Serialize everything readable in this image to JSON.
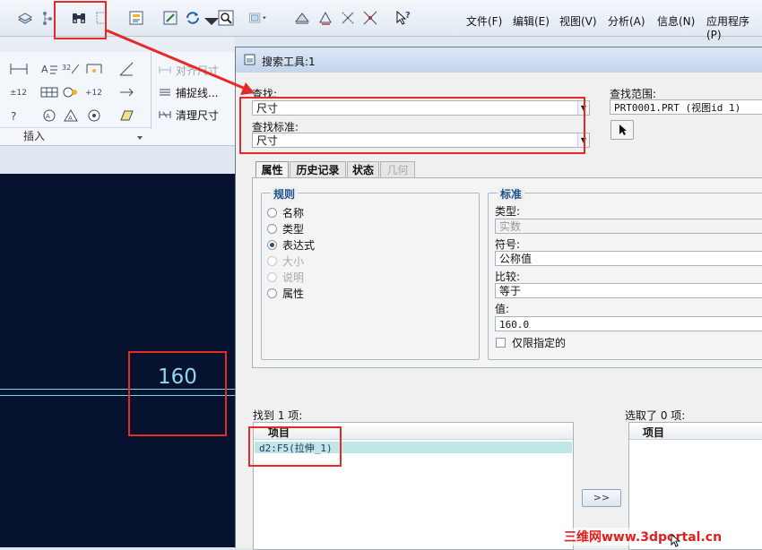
{
  "menu": {
    "file": "文件(F)",
    "edit": "编辑(E)",
    "view": "视图(V)",
    "analysis": "分析(A)",
    "info": "信息(N)",
    "apps": "应用程序(P)"
  },
  "ribbon": {
    "align_dim": "对齐尺寸",
    "capture_line": "捕捉线...",
    "clean_dim": "清理尺寸",
    "insert_label": "插入"
  },
  "canvas": {
    "dimension_value": "160"
  },
  "dialog": {
    "title": "搜索工具:1",
    "find_label": "查找:",
    "find_value": "尺寸",
    "criteria_label": "查找标准:",
    "criteria_value": "尺寸",
    "scope_label": "查找范围:",
    "scope_value": "PRT0001.PRT (视图id 1)",
    "tabs": [
      "属性",
      "历史记录",
      "状态",
      "几何"
    ],
    "rules": {
      "title": "规则",
      "options": [
        {
          "label": "名称",
          "state": "enabled"
        },
        {
          "label": "类型",
          "state": "enabled"
        },
        {
          "label": "表达式",
          "state": "checked"
        },
        {
          "label": "大小",
          "state": "disabled"
        },
        {
          "label": "说明",
          "state": "disabled"
        },
        {
          "label": "属性",
          "state": "enabled"
        }
      ]
    },
    "criteria": {
      "title": "标准",
      "type_label": "类型:",
      "type_value": "实数",
      "symbol_label": "符号:",
      "symbol_value": "公称值",
      "compare_label": "比较:",
      "compare_value": "等于",
      "value_label": "值:",
      "value_value": "160.0",
      "only_specified": "仅限指定的"
    },
    "found_label": "找到 1 项:",
    "found_header": "项目",
    "found_items": [
      "d2:F5(拉伸_1)"
    ],
    "move_button": ">>",
    "selected_label": "选取了 0 项:",
    "selected_header": "项目"
  },
  "watermark": "三维网www.3dportal.cn",
  "colors": {
    "canvas_bg": "#06122e",
    "highlight_red": "#e62a2a",
    "selected_row": "#bfe6e8"
  }
}
